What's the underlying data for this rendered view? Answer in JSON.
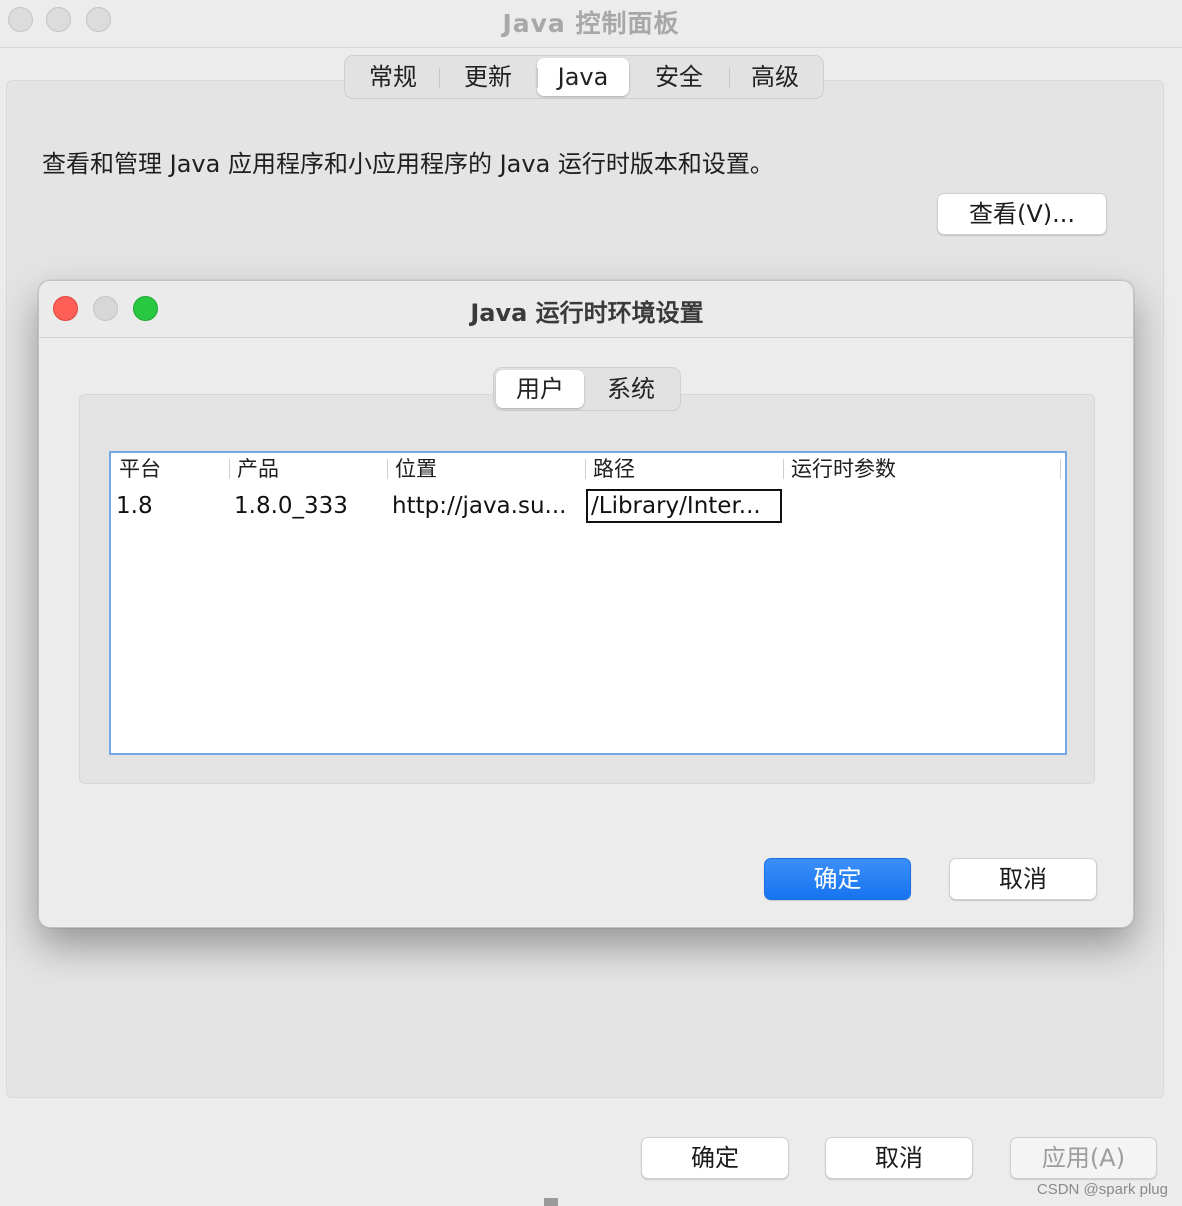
{
  "window": {
    "title": "Java 控制面板"
  },
  "main_tabs": [
    {
      "label": "常规",
      "active": false
    },
    {
      "label": "更新",
      "active": false
    },
    {
      "label": "Java",
      "active": true
    },
    {
      "label": "安全",
      "active": false
    },
    {
      "label": "高级",
      "active": false
    }
  ],
  "java_tab": {
    "description": "查看和管理 Java 应用程序和小应用程序的 Java 运行时版本和设置。",
    "view_button": "查看(V)..."
  },
  "dialog": {
    "title": "Java 运行时环境设置",
    "tabs": [
      {
        "label": "用户",
        "active": true
      },
      {
        "label": "系统",
        "active": false
      }
    ],
    "table": {
      "columns": [
        "平台",
        "产品",
        "位置",
        "路径",
        "运行时参数"
      ],
      "rows": [
        {
          "platform": "1.8",
          "product": "1.8.0_333",
          "location": "http://java.su...",
          "path": "/Library/Inter...",
          "runtime_params": ""
        }
      ]
    },
    "ok_button": "确定",
    "cancel_button": "取消"
  },
  "footer": {
    "ok_button": "确定",
    "cancel_button": "取消",
    "apply_button": "应用(A)"
  },
  "watermark": "CSDN @spark plug",
  "colors": {
    "primary_button": "#1674f0",
    "close_light": "#fe5f57",
    "zoom_light": "#28c840",
    "table_focus_border": "#72a9e4"
  }
}
